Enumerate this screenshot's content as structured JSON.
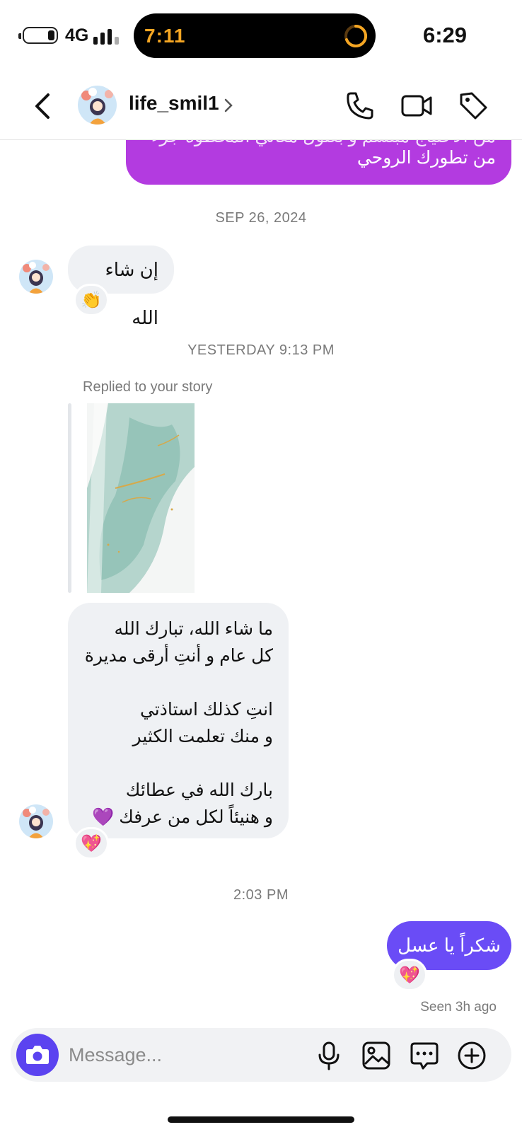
{
  "status": {
    "network": "4G",
    "island_time": "7:11",
    "clock": "6:29"
  },
  "header": {
    "username": "life_smil1"
  },
  "messages": {
    "top_partial_line1": "من الاحتياج مبتسم و بعتول معاني المحطوه جزء",
    "top_partial_line2": "من تطورك الروحي",
    "date1": "SEP 26, 2024",
    "msg1": "إن شاء الله",
    "msg1_reaction": "👏",
    "date2": "YESTERDAY 9:13 PM",
    "replied_label": "Replied to your story",
    "long_lines": [
      "ما شاء الله، تبارك الله",
      "كل عام و أنتِ أرقى مديرة",
      "",
      "انتِ كذلك استاذتي",
      "و منك تعلمت الكثير",
      "",
      "بارك الله في عطائك",
      "و هنيئاً لكل من عرفك 💜"
    ],
    "long_reaction": "💖",
    "date3": "2:03 PM",
    "out_msg": "شكراً يا عسل",
    "out_reaction": "💖",
    "seen": "Seen 3h ago"
  },
  "composer": {
    "placeholder": "Message..."
  },
  "colors": {
    "outgoing": "#6a4cf6",
    "outgoing_purple": "#b33be0",
    "camera_button": "#5b43f0",
    "incoming": "#eff1f4"
  },
  "icons": [
    "back-icon",
    "chevron-right-icon",
    "phone-icon",
    "video-icon",
    "tag-icon",
    "camera-icon",
    "mic-icon",
    "gallery-icon",
    "sticker-icon",
    "plus-icon"
  ]
}
